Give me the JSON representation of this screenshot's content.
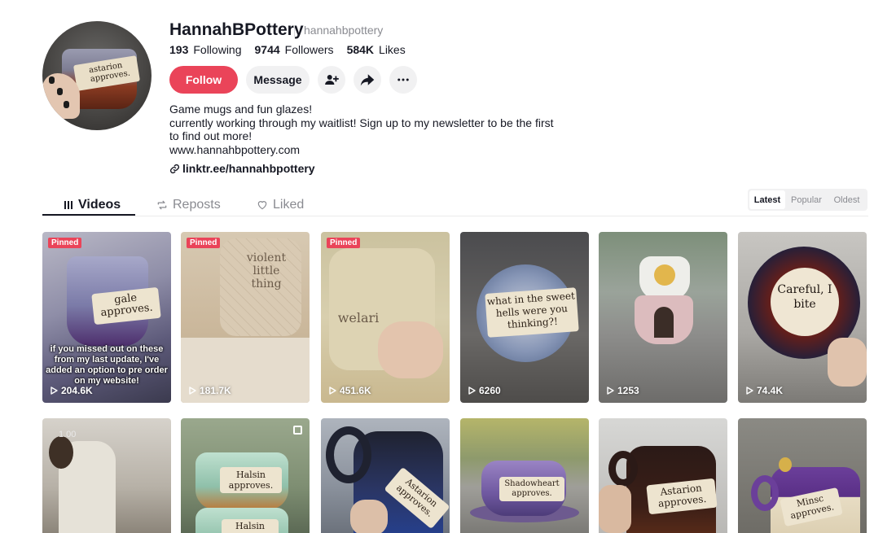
{
  "profile": {
    "username": "HannahBPottery",
    "handle": "hannahbpottery",
    "avatar_mug_text": "astarion approves.",
    "stats": [
      {
        "value": "193",
        "label": "Following"
      },
      {
        "value": "9744",
        "label": "Followers"
      },
      {
        "value": "584K",
        "label": "Likes"
      }
    ],
    "follow_label": "Follow",
    "message_label": "Message",
    "icons": {
      "add_friend": "person-plus-icon",
      "share": "share-arrow-icon",
      "more": "more-horizontal-icon",
      "link": "link-icon"
    },
    "bio": [
      "Game mugs and fun glazes!",
      "currently working through my waitlist! Sign up to my newsletter to be the first to find out more!",
      "www.hannahbpottery.com"
    ],
    "link": "linktr.ee/hannahbpottery"
  },
  "tabs": [
    {
      "label": "Videos",
      "icon": "grid-icon",
      "active": true
    },
    {
      "label": "Reposts",
      "icon": "repost-icon",
      "active": false
    },
    {
      "label": "Liked",
      "icon": "heart-outline-icon",
      "active": false
    }
  ],
  "sort": [
    {
      "label": "Latest",
      "active": true
    },
    {
      "label": "Popular",
      "active": false
    },
    {
      "label": "Oldest",
      "active": false
    }
  ],
  "videos": [
    {
      "pinned": "Pinned",
      "views": "204.6K",
      "mug_text": "gale approves.",
      "overlay": "if you missed out on these from my last update, I've added an option to pre order on my website!"
    },
    {
      "pinned": "Pinned",
      "views": "181.7K",
      "mug_text": "violent little thing"
    },
    {
      "pinned": "Pinned",
      "views": "451.6K",
      "mug_text": "welari"
    },
    {
      "views": "6260",
      "mug_text": "what in the sweet hells were you thinking?!"
    },
    {
      "views": "1253"
    },
    {
      "views": "74.4K",
      "mug_text": "Careful, I bite"
    },
    {
      "timestamp": "1.00"
    },
    {
      "mug_text": "Halsin approves.",
      "mug_text_2": "Halsin",
      "carousel": true
    },
    {
      "mug_text": "Astarion approves."
    },
    {
      "mug_text": "Shadowheart approves."
    },
    {
      "mug_text": "Astarion approves."
    },
    {
      "mug_text": "Minsc approves."
    }
  ],
  "colors": {
    "accent": "#ea4459",
    "text": "#161823",
    "muted": "#8a8b91",
    "chip": "#f1f1f2"
  }
}
